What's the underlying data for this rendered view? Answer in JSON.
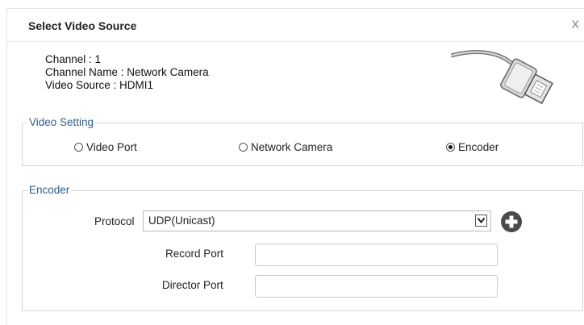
{
  "dialog": {
    "title": "Select Video Source",
    "close_label": "X"
  },
  "info": {
    "channel": "Channel : 1",
    "channel_name": "Channel Name : Network Camera",
    "video_source": "Video Source : HDMI1"
  },
  "video_setting": {
    "legend": "Video Setting",
    "options": [
      {
        "label": "Video Port",
        "selected": false
      },
      {
        "label": "Network Camera",
        "selected": false
      },
      {
        "label": "Encoder",
        "selected": true
      }
    ]
  },
  "encoder": {
    "legend": "Encoder",
    "protocol_label": "Protocol",
    "protocol_value": "UDP(Unicast)",
    "record_port_label": "Record Port",
    "record_port_value": "",
    "director_port_label": "Director Port",
    "director_port_value": ""
  },
  "icons": {
    "connector": "hdmi-cable-icon",
    "add": "plus-circle-icon",
    "dropdown": "chevron-down-icon"
  }
}
